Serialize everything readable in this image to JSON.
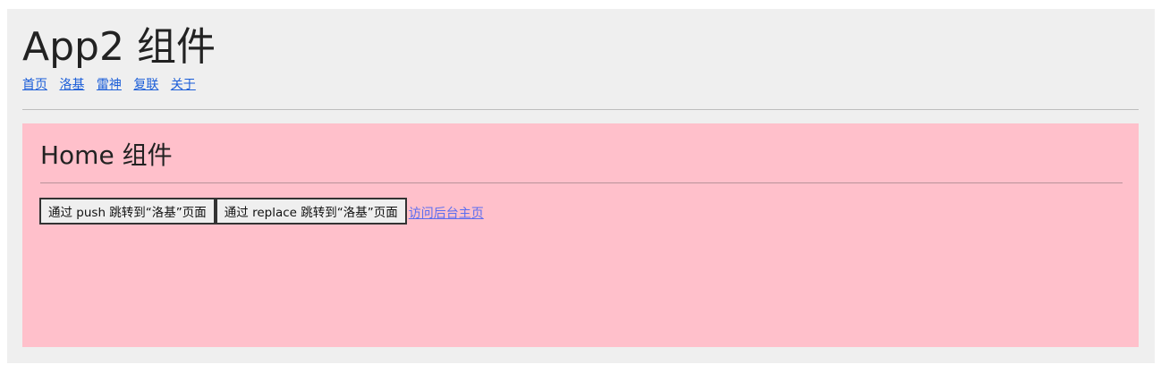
{
  "app": {
    "title": "App2 组件",
    "nav": [
      {
        "label": "首页"
      },
      {
        "label": "洛基"
      },
      {
        "label": "雷神"
      },
      {
        "label": "复联"
      },
      {
        "label": "关于"
      }
    ]
  },
  "home": {
    "title": "Home 组件",
    "push_button": "通过 push 跳转到“洛基”页面",
    "replace_button": "通过 replace 跳转到“洛基”页面",
    "admin_link": "访问后台主页"
  },
  "colors": {
    "app_background": "#efefef",
    "home_background": "#ffc0cb",
    "link": "#1a5dd8"
  }
}
